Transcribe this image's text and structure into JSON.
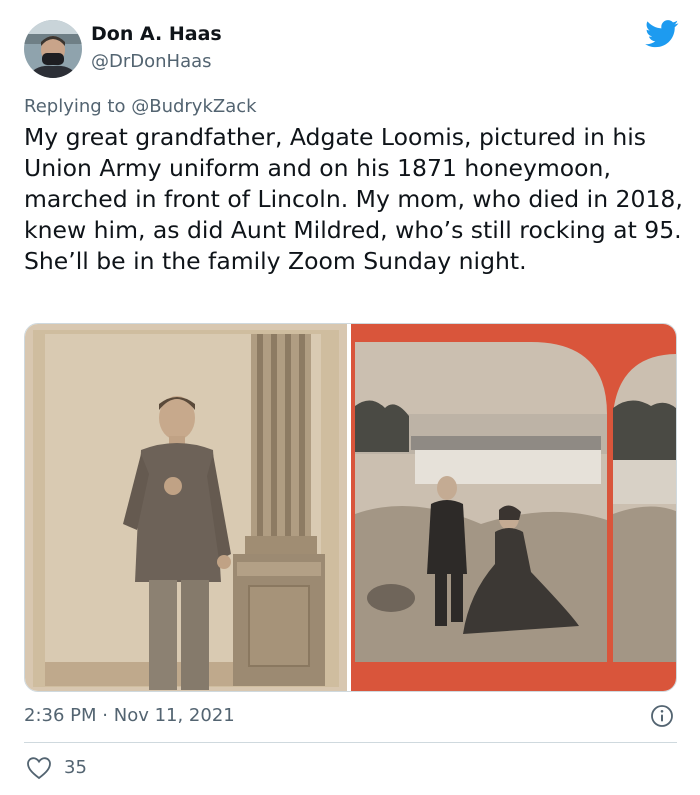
{
  "author": {
    "name": "Don A. Haas",
    "handle": "@DrDonHaas",
    "avatar_icon": "person-avatar"
  },
  "platform_icon": "twitter-bird-icon",
  "brand_color": "#1d9bf0",
  "reply": {
    "prefix": "Replying to",
    "mention": "@BudrykZack"
  },
  "tweet": {
    "text": "My great grandfather, Adgate Loomis, pictured in his Union Army uniform and on his 1871 honeymoon, marched in front of Lincoln. My mom, who died in 2018, knew him, as did Aunt Mildred, who’s still rocking at 95. She’ll be in the family Zoom Sunday night."
  },
  "media": [
    {
      "kind": "photo",
      "subject": "sepia portrait of a soldier in Union Army uniform beside a column"
    },
    {
      "kind": "photo",
      "subject": "stereoview card of a couple seated before a waterfall"
    }
  ],
  "meta": {
    "time": "2:36 PM",
    "separator": "·",
    "date": "Nov 11, 2021",
    "info_icon": "info-icon"
  },
  "engagement": {
    "like_icon": "heart-icon",
    "likes": "35"
  }
}
